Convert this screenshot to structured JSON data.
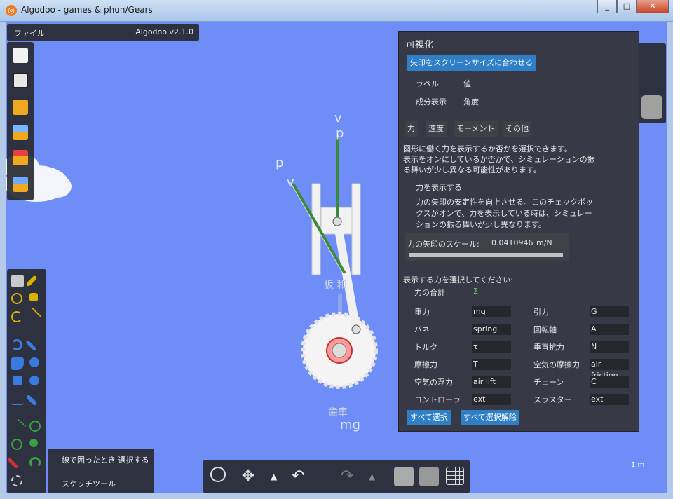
{
  "window": {
    "title": "Algodoo - games & phun/Gears",
    "app_icon": "algodoo-icon",
    "controls": [
      "_",
      "□",
      "✕"
    ]
  },
  "menubar": {
    "file": "ファイル",
    "version": "Algodoo v2.1.0"
  },
  "lefttools": [
    "new-scene-icon",
    "save-icon",
    "open-folder-icon",
    "browse-scenes-icon",
    "photo-icon",
    "image-folder-icon"
  ],
  "drawtools": [
    "sketch-tool-icon",
    "brush-tool-icon",
    "move-tool-icon",
    "drag-tool-icon",
    "rotate-tool-icon",
    "scale-tool-icon",
    "rope-tool-icon",
    "cut-tool-icon",
    "plane-tool-icon",
    "gear-tool-icon",
    "box-tool-icon",
    "circle-tool-icon",
    "fixate-tool-icon",
    "hinge-tool-icon",
    "chain-tool-icon",
    "spring-tool-icon",
    "axle-tool-icon",
    "tracer-tool-icon",
    "laser-tool-icon",
    "thruster-tool-icon",
    "eraser-tool-icon"
  ],
  "options": {
    "lasso": "線で囲ったとき 選択する",
    "sketch": "スケッチツール"
  },
  "bottombar": [
    "zoom-icon",
    "pan-icon",
    "up-arrow-icon",
    "undo-icon",
    "redo-icon",
    "up-arrow-icon",
    "gravity-toggle-icon",
    "air-toggle-icon",
    "grid-icon"
  ],
  "scale_label": "1 m",
  "world_labels": {
    "v1": "v",
    "p1": "p",
    "p2": "p",
    "v2": "v",
    "mg": "mg",
    "frame_text": "板 和",
    "gear_text": "歯車"
  },
  "viz": {
    "title": "可視化",
    "fit_button": "矢印をスクリーンサイズに合わせる",
    "label": "ラベル",
    "value": "値",
    "components": "成分表示",
    "angle": "角度",
    "tabs": [
      "力",
      "速度",
      "モーメント",
      "その他"
    ],
    "selected_tab": "モーメント",
    "desc1": "図形に働く力を表示するか否かを選択できます。",
    "desc2": "表示をオンにしているか否かで、シミュレーションの振",
    "desc3": "る舞いが少し異なる可能性があります。",
    "show_forces": "力を表示する",
    "stab1": "力の矢印の安定性を向上させる。このチェックボッ",
    "stab2": "クスがオンで、力を表示している時は、シミュレー",
    "stab3": "ションの振る舞いが少し異なります。",
    "scale_label": "力の矢印のスケール:",
    "scale_value": "0.0410946",
    "scale_unit": "m/N",
    "select_prompt": "表示する力を選択してください:",
    "sum_label": "力の合計",
    "sum_value": "Σ",
    "forces": [
      {
        "l": "重力",
        "v": "mg",
        "l2": "引力",
        "v2": "G"
      },
      {
        "l": "バネ",
        "v": "spring",
        "l2": "回転軸",
        "v2": "A"
      },
      {
        "l": "トルク",
        "v": "τ",
        "l2": "垂直抗力",
        "v2": "N"
      },
      {
        "l": "摩擦力",
        "v": "T",
        "l2": "空気の摩擦力",
        "v2": "air friction"
      },
      {
        "l": "空気の浮力",
        "v": "air lift",
        "l2": "チェーン",
        "v2": "C"
      },
      {
        "l": "コントローラ",
        "v": "ext",
        "l2": "スラスター",
        "v2": "ext"
      }
    ],
    "select_all": "すべて選択",
    "deselect_all": "すべて選択解除"
  }
}
